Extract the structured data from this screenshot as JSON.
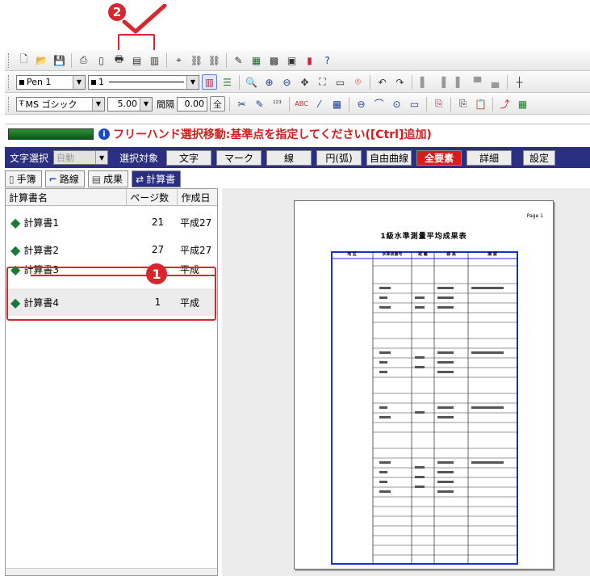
{
  "callouts": {
    "step1": "1",
    "step2": "2"
  },
  "toolbar": {
    "pen_label": "Pen 1",
    "line_weight_label": "1",
    "font_name": "MS ゴシック",
    "font_size": "5.00",
    "spacing_label": "間隔",
    "spacing_value": "0.00",
    "all_label": "全"
  },
  "status": {
    "message": "フリーハンド選択移動:基準点を指定してください([Ctrl]追加)"
  },
  "mode_bar": {
    "text_select_label": "文字選択",
    "auto_value": "自動",
    "select_target_label": "選択対象",
    "buttons": [
      "文字",
      "マーク",
      "線",
      "円(弧)",
      "自由曲線",
      "全要素",
      "詳細",
      "設定"
    ]
  },
  "tabs": [
    "手簿",
    "路線",
    "成果",
    "計算書"
  ],
  "list": {
    "headers": [
      "計算書名",
      "ページ数",
      "作成日"
    ],
    "rows": [
      {
        "name": "計算書1",
        "pages": "21",
        "date": "平成27"
      },
      {
        "name": "計算書2",
        "pages": "27",
        "date": "平成27"
      },
      {
        "name": "計算書3",
        "pages": "",
        "date": "平成"
      },
      {
        "name": "計算書4",
        "pages": "1",
        "date": "平成"
      }
    ]
  },
  "document": {
    "page_label": "Page 1",
    "title": "1級水準測量平均成果表",
    "headers": [
      "地 区",
      "水準点番号",
      "距 離",
      "標 高",
      "摘 要"
    ]
  },
  "colors": {
    "accent": "#2b2f82",
    "callout_red": "#d8262f",
    "status_text": "#d61c1c",
    "doc_blue": "#1a2fd6"
  }
}
